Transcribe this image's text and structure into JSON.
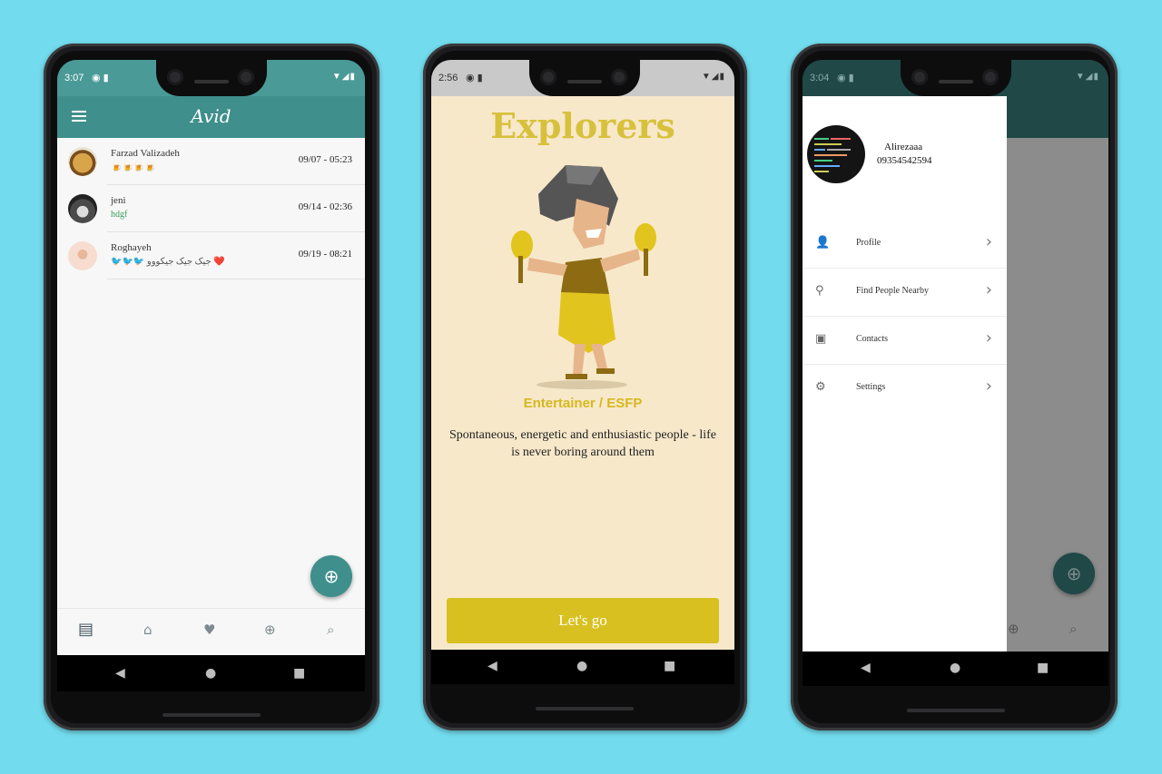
{
  "phone1": {
    "status": {
      "time": "3:07"
    },
    "app_title": "Avid",
    "chats": [
      {
        "name": "Farzad Valizadeh",
        "message": "🍺🍺🍺🍺",
        "date": "09/07 - 05:23",
        "avatar_color": "#b88a3a"
      },
      {
        "name": "jeni",
        "message": "hdgf",
        "date": "09/14 - 02:36",
        "avatar_color": "#5a5a5a"
      },
      {
        "name": "Roghayeh",
        "message": "🐦🐦🐦 جیک جیک جیکووو ❤️",
        "date": "09/19 - 08:21",
        "avatar_color": "#f3d7c8"
      }
    ],
    "fab_icon": "add-circle-icon",
    "bottom_nav": [
      "chat-icon",
      "home-icon",
      "heart-icon",
      "add-circle-icon",
      "search-icon"
    ]
  },
  "phone2": {
    "status": {
      "time": "2:56"
    },
    "title": "Explorers",
    "personality": "Entertainer / ESFP",
    "description": "Spontaneous, energetic and enthusiastic people - life is never boring around them",
    "button_label": "Let's go"
  },
  "phone3": {
    "status": {
      "time": "3:04"
    },
    "profile_name": "Alirezaaa",
    "profile_phone": "09354542594",
    "menu": [
      {
        "label": "Profile",
        "icon": "person-icon"
      },
      {
        "label": "Find People Nearby",
        "icon": "location-icon"
      },
      {
        "label": "Contacts",
        "icon": "contacts-icon"
      },
      {
        "label": "Settings",
        "icon": "gear-icon"
      }
    ]
  },
  "colors": {
    "background": "#72dcee",
    "teal": "#3f8f8c",
    "yellow": "#d8c020",
    "cream": "#f7e8ca"
  }
}
